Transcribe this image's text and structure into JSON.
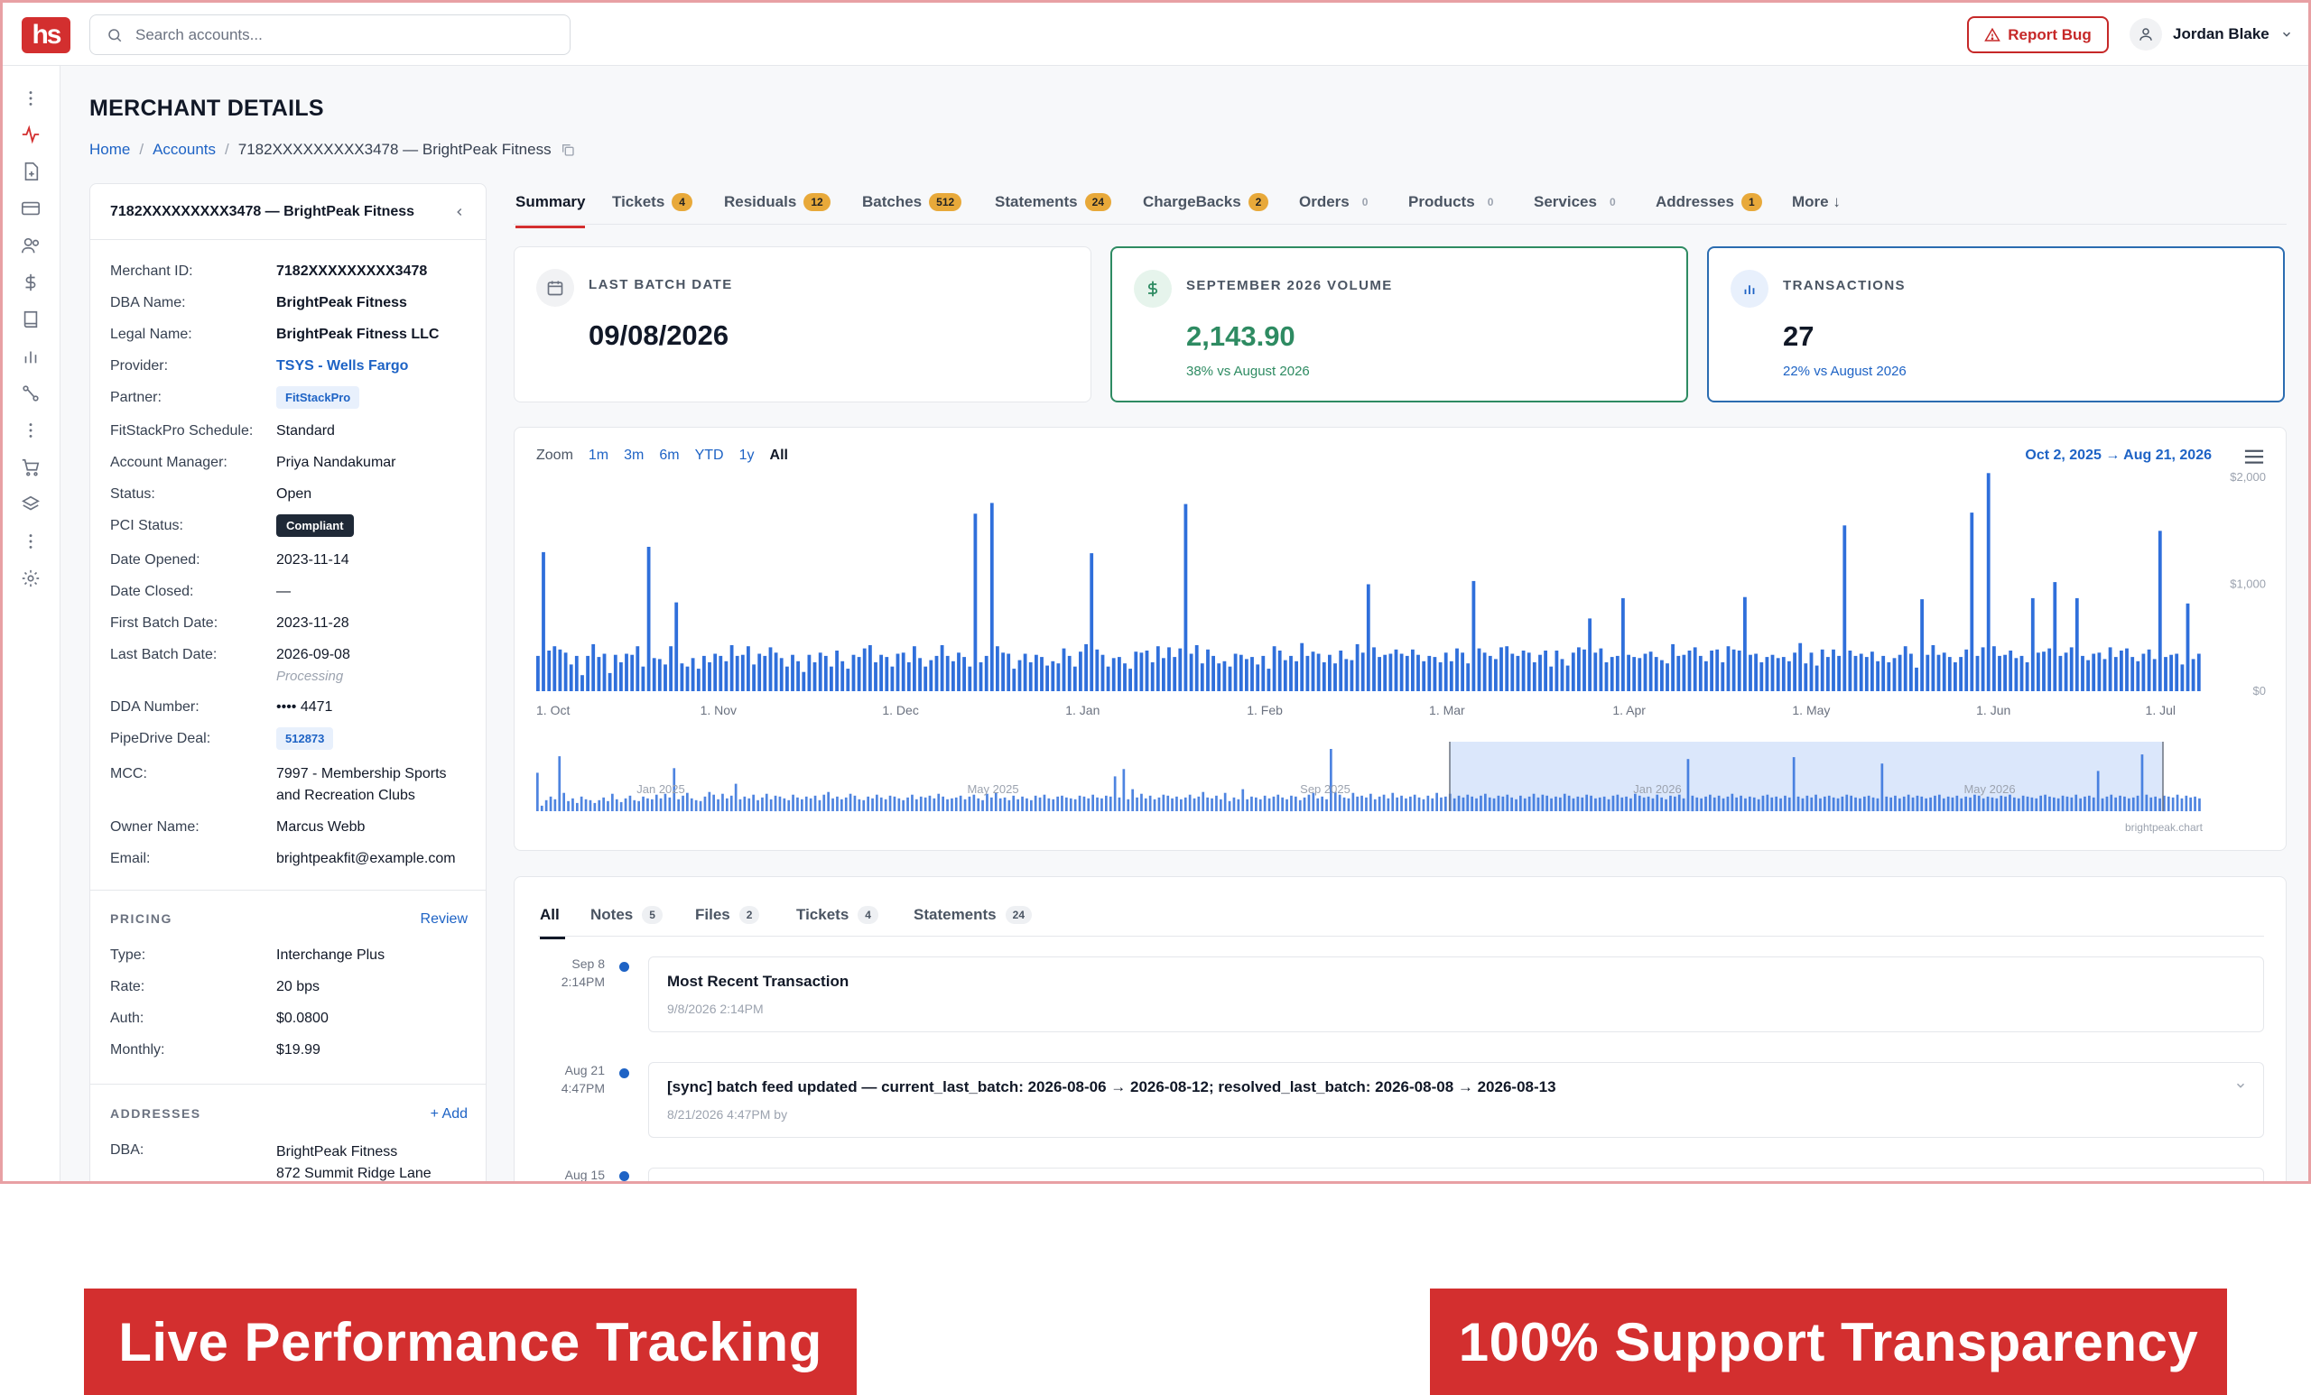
{
  "app": {
    "logo_text": "hs",
    "search_placeholder": "Search accounts...",
    "report_bug_label": "Report Bug",
    "user_name": "Jordan Blake",
    "colors": {
      "brand": "#d32f2f",
      "link": "#1e63c5",
      "success": "#2e8b62",
      "badge": "#e8a93a",
      "bar": "#2f6fdb"
    }
  },
  "rail": {
    "icons": [
      "more-vertical-icon",
      "activity-icon",
      "file-plus-icon",
      "credit-card-icon",
      "users-icon",
      "dollar-icon",
      "book-icon",
      "bar-chart-icon",
      "route-icon",
      "more-vertical-icon",
      "cart-icon",
      "layers-icon",
      "more-vertical-icon",
      "settings-icon"
    ]
  },
  "page": {
    "title": "MERCHANT DETAILS",
    "breadcrumb": {
      "home": "Home",
      "accounts": "Accounts",
      "current": "7182XXXXXXXXX3478 — BrightPeak Fitness"
    }
  },
  "merchant": {
    "card_title": "7182XXXXXXXXX3478 — BrightPeak Fitness",
    "fields": {
      "merchant_id_label": "Merchant ID:",
      "merchant_id": "7182XXXXXXXXX3478",
      "dba_label": "DBA Name:",
      "dba": "BrightPeak Fitness",
      "legal_label": "Legal Name:",
      "legal": "BrightPeak Fitness LLC",
      "provider_label": "Provider:",
      "provider": "TSYS - Wells Fargo",
      "partner_label": "Partner:",
      "partner": "FitStackPro",
      "schedule_label": "FitStackPro Schedule:",
      "schedule": "Standard",
      "manager_label": "Account Manager:",
      "manager": "Priya Nandakumar",
      "status_label": "Status:",
      "status": "Open",
      "pci_label": "PCI Status:",
      "pci": "Compliant",
      "opened_label": "Date Opened:",
      "opened": "2023-11-14",
      "closed_label": "Date Closed:",
      "closed": "—",
      "first_batch_label": "First Batch Date:",
      "first_batch": "2023-11-28",
      "last_batch_label": "Last Batch Date:",
      "last_batch": "2026-09-08",
      "last_batch_note": "Processing",
      "dda_label": "DDA Number:",
      "dda": "•••• 4471",
      "pipedrive_label": "PipeDrive Deal:",
      "pipedrive": "512873",
      "mcc_label": "MCC:",
      "mcc_line1": "7997 - Membership Sports",
      "mcc_line2": "and Recreation Clubs",
      "owner_label": "Owner Name:",
      "owner": "Marcus Webb",
      "email_label": "Email:",
      "email": "brightpeakfit@example.com"
    },
    "pricing": {
      "label": "PRICING",
      "action": "Review",
      "type_label": "Type:",
      "type": "Interchange Plus",
      "rate_label": "Rate:",
      "rate": "20 bps",
      "auth_label": "Auth:",
      "auth": "$0.0800",
      "monthly_label": "Monthly:",
      "monthly": "$19.99"
    },
    "addresses": {
      "label": "ADDRESSES",
      "action": "+ Add",
      "dba_label": "DBA:",
      "dba_line1": "BrightPeak Fitness",
      "dba_line2": "872 Summit Ridge Lane"
    }
  },
  "tabs": [
    {
      "label": "Summary",
      "count": "",
      "style": "active"
    },
    {
      "label": "Tickets",
      "count": "4",
      "style": "amber"
    },
    {
      "label": "Residuals",
      "count": "12",
      "style": "amber"
    },
    {
      "label": "Batches",
      "count": "512",
      "style": "amber"
    },
    {
      "label": "Statements",
      "count": "24",
      "style": "amber"
    },
    {
      "label": "ChargeBacks",
      "count": "2",
      "style": "amber"
    },
    {
      "label": "Orders",
      "count": "0",
      "style": "gray"
    },
    {
      "label": "Products",
      "count": "0",
      "style": "gray"
    },
    {
      "label": "Services",
      "count": "0",
      "style": "gray"
    },
    {
      "label": "Addresses",
      "count": "1",
      "style": "amber"
    },
    {
      "label": "More ↓",
      "count": "",
      "style": "plain"
    }
  ],
  "stats": {
    "last_batch": {
      "label": "LAST BATCH DATE",
      "value": "09/08/2026"
    },
    "volume": {
      "label": "SEPTEMBER 2026 VOLUME",
      "value": "2,143.90",
      "sub": "38% vs August 2026"
    },
    "transactions": {
      "label": "TRANSACTIONS",
      "value": "27",
      "sub": "22% vs August 2026"
    }
  },
  "chart_panel": {
    "zoom_label": "Zoom",
    "zoom_options": [
      "1m",
      "3m",
      "6m",
      "YTD",
      "1y",
      "All"
    ],
    "zoom_selected": "All",
    "range_label": "Oct 2, 2025 → Aug 21, 2026",
    "credit": "brightpeak.chart"
  },
  "chart_data": {
    "type": "bar",
    "title": "",
    "xlabel": "",
    "ylabel": "",
    "ylim": [
      0,
      2000
    ],
    "y_ticks": [
      "$2,000",
      "$1,000",
      "$0"
    ],
    "x_ticks": [
      "1. Oct",
      "1. Nov",
      "1. Dec",
      "1. Jan",
      "1. Feb",
      "1. Mar",
      "1. Apr",
      "1. May",
      "1. Jun",
      "1. Jul"
    ],
    "navigator_ticks": [
      "Jan 2025",
      "May 2025",
      "Sep 2025",
      "Jan 2026",
      "May 2026"
    ],
    "series": [
      {
        "values": [
          330,
          1300,
          380,
          420,
          390,
          360,
          250,
          330,
          150,
          330,
          440,
          320,
          350,
          170,
          340,
          270,
          350,
          340,
          420,
          230,
          1350,
          310,
          300,
          250,
          420,
          830,
          260,
          230,
          310,
          210,
          330,
          270,
          350,
          330,
          280,
          430,
          330,
          340,
          420,
          250,
          350,
          330,
          410,
          360,
          310,
          230,
          340,
          280,
          180,
          340,
          270,
          360,
          330,
          230,
          380,
          280,
          210,
          340,
          320,
          400,
          430,
          270,
          340,
          320,
          230,
          350,
          360,
          270,
          420,
          310,
          230,
          290,
          330,
          430,
          330,
          280,
          360,
          320,
          230,
          1660,
          270,
          330,
          1760,
          420,
          360,
          350,
          210,
          290,
          350,
          270,
          340,
          320,
          240,
          280,
          260,
          400,
          330,
          230,
          370,
          440,
          1290,
          390,
          340,
          230,
          310,
          320,
          260,
          210,
          370,
          360,
          380,
          270,
          420,
          310,
          410,
          320,
          400,
          1750,
          350,
          430,
          260,
          390,
          330,
          260,
          280,
          230,
          350,
          340,
          300,
          320,
          250,
          330,
          210,
          420,
          380,
          290,
          330,
          280,
          450,
          330,
          370,
          350,
          270,
          340,
          260,
          380,
          300,
          290,
          440,
          360,
          1000,
          410,
          320,
          340,
          350,
          390,
          350,
          330,
          390,
          340,
          280,
          330,
          320,
          270,
          360,
          280,
          400,
          360,
          260,
          1030,
          400,
          360,
          330,
          300,
          410,
          420,
          350,
          330,
          380,
          360,
          270,
          340,
          380,
          230,
          380,
          300,
          240,
          360,
          410,
          390,
          680,
          360,
          400,
          270,
          320,
          330,
          870,
          340,
          320,
          310,
          350,
          370,
          320,
          290,
          260,
          440,
          330,
          340,
          380,
          410,
          330,
          280,
          380,
          390,
          270,
          420,
          390,
          380,
          880,
          340,
          350,
          270,
          320,
          340,
          310,
          320,
          280,
          360,
          450,
          260,
          360,
          240,
          390,
          320,
          390,
          330,
          1550,
          380,
          330,
          350,
          320,
          370,
          280,
          330,
          270,
          310,
          340,
          420,
          350,
          220,
          860,
          340,
          430,
          340,
          360,
          320,
          270,
          320,
          390,
          1670,
          330,
          410,
          2040,
          420,
          330,
          340,
          380,
          310,
          330,
          270,
          870,
          360,
          370,
          400,
          1020,
          330,
          360,
          410,
          870,
          330,
          290,
          350,
          360,
          300,
          410,
          320,
          380,
          400,
          320,
          280,
          350,
          390,
          300,
          1500,
          320,
          340,
          350,
          250,
          820,
          300,
          350
        ]
      }
    ],
    "navigator_values": [
      420,
      60,
      120,
      160,
      130,
      600,
      200,
      110,
      140,
      90,
      160,
      130,
      120,
      90,
      120,
      150,
      110,
      190,
      130,
      100,
      140,
      170,
      120,
      110,
      160,
      140,
      130,
      180,
      140,
      190,
      150,
      470,
      130,
      170,
      200,
      140,
      120,
      110,
      160,
      210,
      180,
      130,
      190,
      140,
      170,
      300,
      130,
      160,
      140,
      180,
      120,
      150,
      190,
      130,
      170,
      160,
      140,
      120,
      180,
      150,
      130,
      160,
      140,
      170,
      120,
      180,
      210,
      140,
      160,
      130,
      150,
      190,
      170,
      130,
      120,
      160,
      140,
      180,
      150,
      130,
      170,
      160,
      140,
      120,
      150,
      180,
      130,
      160,
      150,
      170,
      140,
      190,
      160,
      130,
      140,
      150,
      170,
      130,
      160,
      180,
      140,
      120,
      190,
      150,
      200,
      140,
      150,
      120,
      170,
      130,
      160,
      140,
      120,
      170,
      150,
      180,
      140,
      130,
      160,
      170,
      150,
      140,
      130,
      170,
      160,
      140,
      180,
      150,
      140,
      170,
      160,
      380,
      150,
      460,
      130,
      240,
      150,
      190,
      140,
      170,
      130,
      150,
      180,
      170,
      140,
      160,
      130,
      150,
      180,
      140,
      160,
      210,
      150,
      140,
      170,
      130,
      200,
      110,
      150,
      130,
      240,
      130,
      160,
      150,
      130,
      170,
      140,
      160,
      180,
      150,
      130,
      170,
      160,
      120,
      150,
      180,
      200,
      140,
      160,
      130,
      680,
      210,
      180,
      150,
      140,
      200,
      160,
      170,
      150,
      190,
      130,
      160,
      180,
      140,
      200,
      150,
      170,
      140,
      160,
      180,
      150,
      130,
      170,
      140,
      200,
      150,
      160,
      190,
      140,
      170,
      150,
      180,
      160,
      140,
      170,
      190,
      150,
      140,
      170,
      160,
      180,
      150,
      130,
      170,
      140,
      160,
      190,
      150,
      180,
      170,
      140,
      160,
      150,
      190,
      170,
      140,
      160,
      150,
      180,
      170,
      140,
      150,
      160,
      130,
      170,
      180,
      150,
      160,
      140,
      190,
      170,
      150,
      160,
      140,
      180,
      150,
      130,
      170,
      160,
      180,
      140,
      570,
      170,
      150,
      140,
      160,
      180,
      150,
      170,
      140,
      160,
      190,
      150,
      170,
      140,
      160,
      150,
      130,
      170,
      180,
      150,
      160,
      140,
      170,
      150,
      590,
      160,
      140,
      170,
      150,
      180,
      140,
      160,
      170,
      150,
      140,
      160,
      180,
      170,
      150,
      140,
      160,
      170,
      150,
      140,
      520,
      160,
      150,
      170,
      140,
      160,
      180,
      150,
      170,
      160,
      140,
      150,
      170,
      180,
      140,
      160,
      150,
      170,
      140,
      160,
      150,
      180,
      170,
      140,
      160,
      150,
      140,
      170,
      160,
      180,
      150,
      140,
      170,
      160,
      150,
      140,
      170,
      180,
      160,
      150,
      140,
      170,
      160,
      150,
      180,
      140,
      160,
      170,
      150,
      440,
      140,
      160,
      180,
      150,
      170,
      160,
      140,
      150,
      170,
      620,
      180,
      150,
      160,
      140,
      170,
      160,
      150,
      180,
      140,
      170,
      150,
      160,
      140
    ]
  },
  "activity": {
    "tabs": [
      {
        "label": "All",
        "count": ""
      },
      {
        "label": "Notes",
        "count": "5"
      },
      {
        "label": "Files",
        "count": "2"
      },
      {
        "label": "Tickets",
        "count": "4"
      },
      {
        "label": "Statements",
        "count": "24"
      }
    ],
    "items": [
      {
        "date": "Sep 8",
        "time": "2:14PM",
        "title": "Most Recent Transaction",
        "meta": "9/8/2026 2:14PM"
      },
      {
        "date": "Aug 21",
        "time": "4:47PM",
        "title": "[sync] batch feed updated — current_last_batch: 2026-08-06 → 2026-08-12; resolved_last_batch: 2026-08-08 → 2026-08-13",
        "meta": "8/21/2026 4:47PM by"
      },
      {
        "date": "Aug 15",
        "time": "",
        "title": "",
        "meta": ""
      }
    ]
  },
  "banners": {
    "left": "Live Performance Tracking",
    "right": "100% Support Transparency"
  }
}
